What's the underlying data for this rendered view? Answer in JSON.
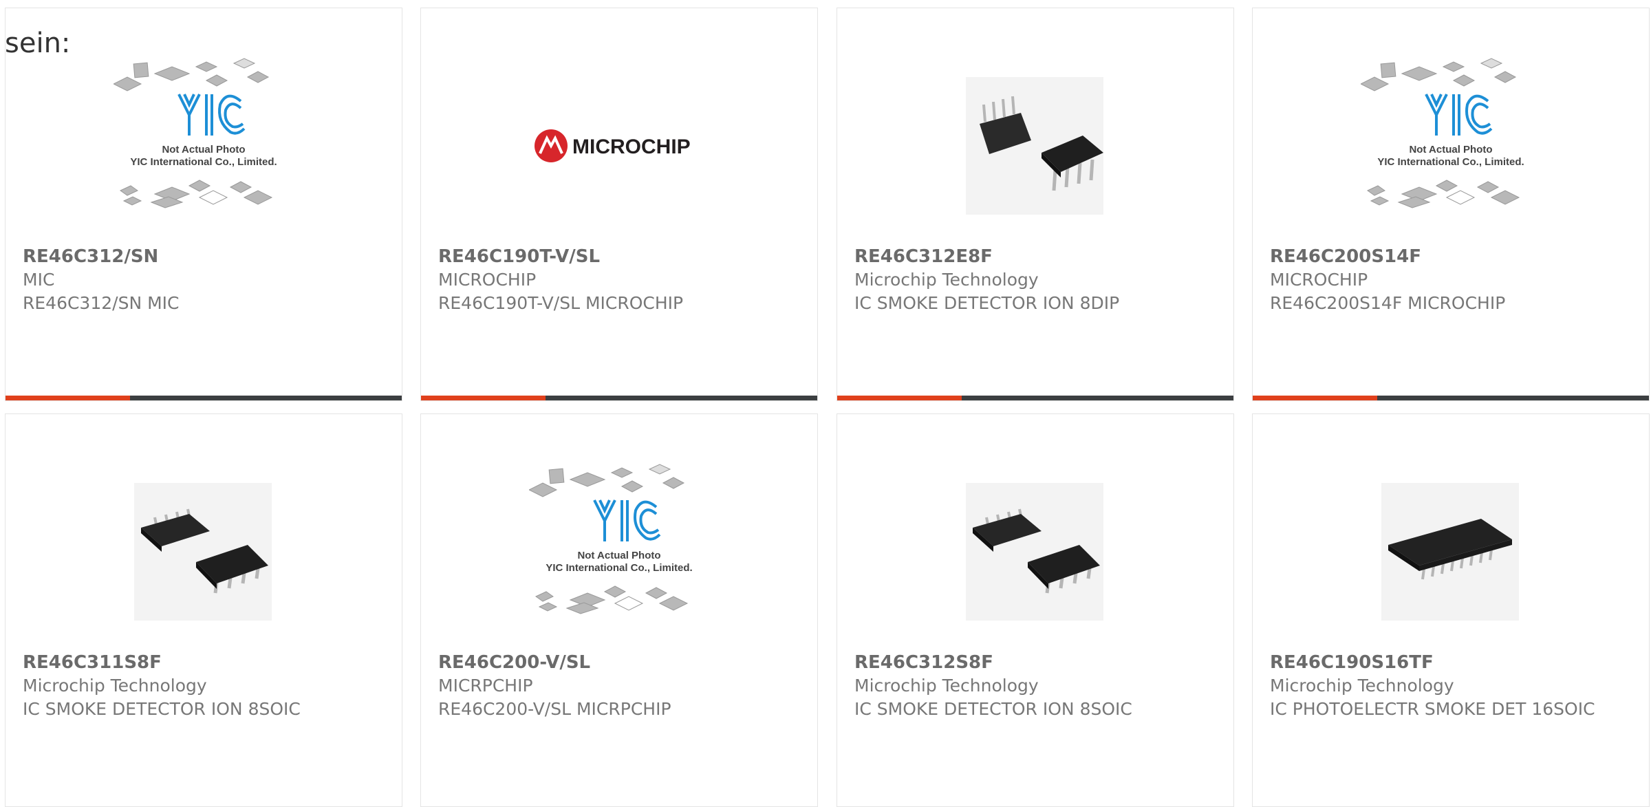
{
  "intro_text": "sein:",
  "colors": {
    "accent": "#e0401c",
    "bar": "#3c3f41",
    "microchip_red": "#d7262b",
    "yic_blue": "#1d8fd6"
  },
  "placeholder": {
    "line1": "Not Actual Photo",
    "line2": "YIC International Co., Limited.",
    "logo_text": "YIC"
  },
  "logo": {
    "text": "MICROCHIP"
  },
  "products": [
    {
      "part": "RE46C312/SN",
      "manufacturer": "MIC",
      "description": "RE46C312/SN MIC",
      "image": "yic-placeholder"
    },
    {
      "part": "RE46C190T-V/SL",
      "manufacturer": "MICROCHIP",
      "description": "RE46C190T-V/SL MICROCHIP",
      "image": "microchip-logo"
    },
    {
      "part": "RE46C312E8F",
      "manufacturer": "Microchip Technology",
      "description": "IC SMOKE DETECTOR ION 8DIP",
      "image": "dip8-chip"
    },
    {
      "part": "RE46C200S14F",
      "manufacturer": "MICROCHIP",
      "description": "RE46C200S14F MICROCHIP",
      "image": "yic-placeholder"
    },
    {
      "part": "RE46C311S8F",
      "manufacturer": "Microchip Technology",
      "description": "IC SMOKE DETECTOR ION 8SOIC",
      "image": "soic8-chip"
    },
    {
      "part": "RE46C200-V/SL",
      "manufacturer": "MICRPCHIP",
      "description": "RE46C200-V/SL MICRPCHIP",
      "image": "yic-placeholder"
    },
    {
      "part": "RE46C312S8F",
      "manufacturer": "Microchip Technology",
      "description": "IC SMOKE DETECTOR ION 8SOIC",
      "image": "soic8-chip"
    },
    {
      "part": "RE46C190S16TF",
      "manufacturer": "Microchip Technology",
      "description": "IC PHOTOELECTR SMOKE DET 16SOIC",
      "image": "soic16-chip"
    }
  ]
}
